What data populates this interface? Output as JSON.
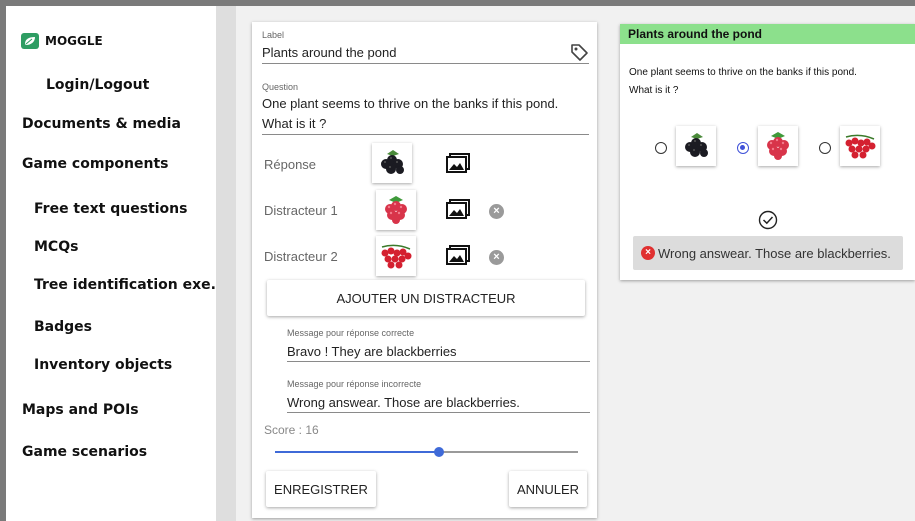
{
  "app": {
    "logo_text": "MOGGLE"
  },
  "sidebar": {
    "login": "Login/Logout",
    "documents": "Documents & media",
    "game_components": "Game components",
    "free_text": "Free text questions",
    "mcqs": "MCQs",
    "tree": "Tree identification exe.",
    "badges": "Badges",
    "inventory": "Inventory objects",
    "maps": "Maps and POIs",
    "scenarios": "Game scenarios"
  },
  "form": {
    "label_caption": "Label",
    "label_value": "Plants around the pond",
    "question_caption": "Question",
    "question_line1": "One plant seems to thrive on the banks if this pond.",
    "question_line2": "What is it ?",
    "answer_label": "Réponse",
    "distractor1_label": "Distracteur 1",
    "distractor2_label": "Distracteur 2",
    "add_distractor": "AJOUTER UN DISTRACTEUR",
    "correct_caption": "Message pour réponse correcte",
    "correct_value": "Bravo ! They are blackberries",
    "incorrect_caption": "Message pour réponse incorrecte",
    "incorrect_value": "Wrong answear. Those are blackberries.",
    "score_label": "Score : 16",
    "score_fraction": 0.54,
    "save": "ENREGISTRER",
    "cancel": "ANNULER"
  },
  "preview": {
    "title": "Plants around the pond",
    "question_line1": "One plant seems to thrive on the banks if this pond.",
    "question_line2": "What is it ?",
    "selected_option": 2,
    "error_message": "Wrong answear. Those are blackberries."
  },
  "colors": {
    "accent": "#3f6ad8",
    "header_green": "#8ce08c",
    "logo_green": "#2e9d63",
    "error_red": "#e03030"
  },
  "icons": [
    "leaf-logo-icon",
    "tag-icon",
    "blackberry-image",
    "raspberry-image",
    "redcurrant-image",
    "picture-icon",
    "delete-icon",
    "checkmark-icon",
    "error-icon"
  ]
}
